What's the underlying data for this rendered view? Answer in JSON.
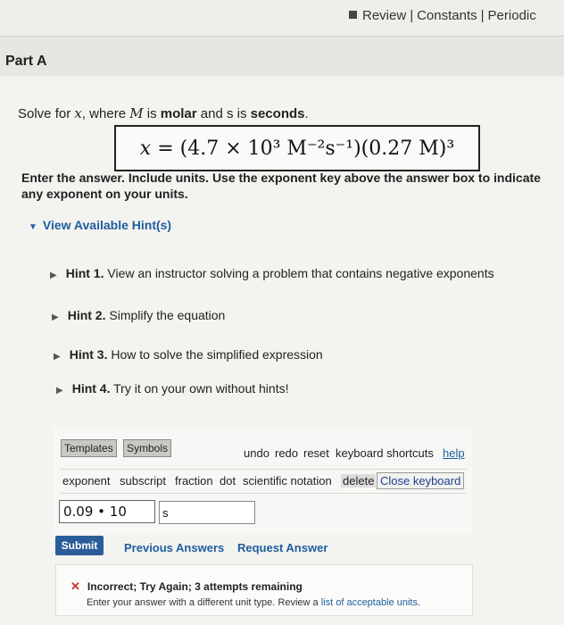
{
  "header": {
    "links": [
      "Review",
      "Constants",
      "Periodic"
    ],
    "separator": "|"
  },
  "part": {
    "label": "Part A"
  },
  "question": {
    "prefix": "Solve for ",
    "variable": "x",
    "middle": ", where ",
    "unit_M": "M",
    "is_molar": " is ",
    "molar": "molar",
    "and_s": " and s is ",
    "seconds": "seconds",
    "end": "."
  },
  "formula": {
    "lhs": "x = ",
    "text": "(4.7 × 10³ M⁻²s⁻¹)(0.27 M)³"
  },
  "instructions": "Enter the answer. Include units. Use the exponent key above the answer box to indicate any exponent on your units.",
  "hints": {
    "toggle_label": "View Available Hint(s)",
    "items": [
      {
        "num": "Hint 1.",
        "text": "View an instructor solving a problem that contains negative exponents"
      },
      {
        "num": "Hint 2.",
        "text": "Simplify the equation"
      },
      {
        "num": "Hint 3.",
        "text": "How to solve the simplified expression"
      },
      {
        "num": "Hint 4.",
        "text": "Try it on your own without hints!"
      }
    ]
  },
  "toolbar": {
    "templates": "Templates",
    "symbols": "Symbols",
    "undo": "undo",
    "redo": "redo",
    "reset": "reset",
    "shortcuts": "keyboard shortcuts",
    "help": "help"
  },
  "tools": {
    "exponent": "exponent",
    "subscript": "subscript",
    "fraction": "fraction",
    "dot": "dot",
    "scientific": "scientific notation",
    "delete": "delete",
    "close": "Close keyboard"
  },
  "answer": {
    "value": "0.09 • 10",
    "unit": "s"
  },
  "actions": {
    "submit": "Submit",
    "previous": "Previous Answers",
    "request": "Request Answer"
  },
  "feedback": {
    "title": "Incorrect; Try Again; 3 attempts remaining",
    "body_prefix": "Enter your answer with a different unit type. Review a ",
    "body_link": "list of acceptable units",
    "body_suffix": "."
  }
}
